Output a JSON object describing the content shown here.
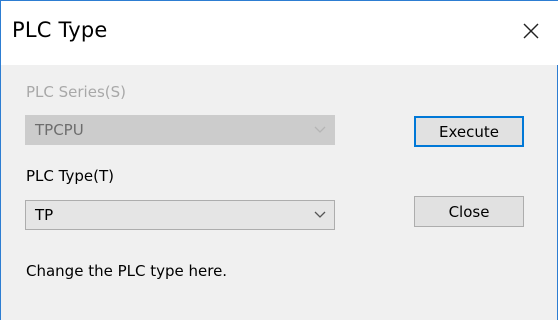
{
  "window": {
    "title": "PLC Type",
    "close_icon": "close-icon"
  },
  "plc_series": {
    "label": "PLC Series(S)",
    "value": "TPCPU",
    "enabled": false
  },
  "plc_type": {
    "label": "PLC Type(T)",
    "value": "TP",
    "enabled": true
  },
  "buttons": {
    "execute": "Execute",
    "close": "Close"
  },
  "hint": "Change the PLC type here.",
  "colors": {
    "accent": "#0078d7",
    "window_border": "#2d7dd2",
    "disabled_text": "#a8a8a8"
  }
}
